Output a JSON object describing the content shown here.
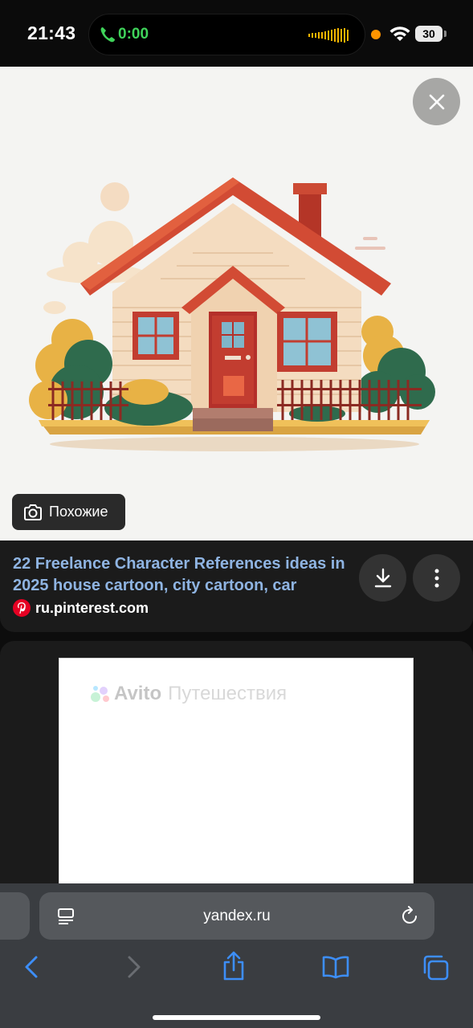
{
  "status_bar": {
    "time": "21:43",
    "call_timer": "0:00",
    "battery": "30",
    "icons": [
      "phone-icon",
      "sound-wave-icon",
      "orange-privacy-dot",
      "wifi-icon",
      "battery-icon"
    ]
  },
  "hero": {
    "close_icon": "close-icon",
    "similar_label": "Похожие",
    "similar_icon": "camera-search-icon"
  },
  "result": {
    "title": "22 Freelance Character References ideas in 2025 house cartoon, city cartoon, car",
    "source": "ru.pinterest.com",
    "source_icon": "pinterest-icon",
    "download_icon": "download-icon",
    "more_icon": "more-vertical-icon"
  },
  "next_result": {
    "logo_name": "Avito",
    "logo_suffix": "Путешествия"
  },
  "browser": {
    "url": "yandex.ru",
    "reader_icon": "reader-icon",
    "reload_icon": "reload-icon",
    "nav": [
      "back-icon",
      "forward-icon",
      "share-icon",
      "bookmarks-icon",
      "tabs-icon"
    ]
  },
  "colors": {
    "link_blue": "#8fb4e2",
    "accent_blue": "#3d8ef7",
    "call_green": "#3fd35a",
    "pinterest_red": "#e60023"
  }
}
